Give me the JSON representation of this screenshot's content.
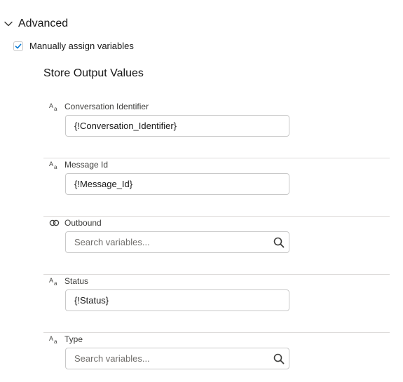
{
  "section": {
    "title": "Advanced",
    "expanded": true
  },
  "checkbox": {
    "label": "Manually assign variables",
    "checked": true
  },
  "subsection": {
    "title": "Store Output Values"
  },
  "fields": [
    {
      "label": "Conversation Identifier",
      "type_icon": "text-type-icon",
      "value": "{!Conversation_Identifier}",
      "placeholder": ""
    },
    {
      "label": "Message Id",
      "type_icon": "text-type-icon",
      "value": "{!Message_Id}",
      "placeholder": ""
    },
    {
      "label": "Outbound",
      "type_icon": "boolean-type-icon",
      "value": "",
      "placeholder": "Search variables..."
    },
    {
      "label": "Status",
      "type_icon": "text-type-icon",
      "value": "{!Status}",
      "placeholder": ""
    },
    {
      "label": "Type",
      "type_icon": "text-type-icon",
      "value": "",
      "placeholder": "Search variables..."
    }
  ],
  "colors": {
    "text": "#181818",
    "label": "#3e3e3c",
    "border": "#c9c9c9",
    "divider": "#dddbda",
    "check": "#0176d3",
    "icon": "#706e6b"
  }
}
